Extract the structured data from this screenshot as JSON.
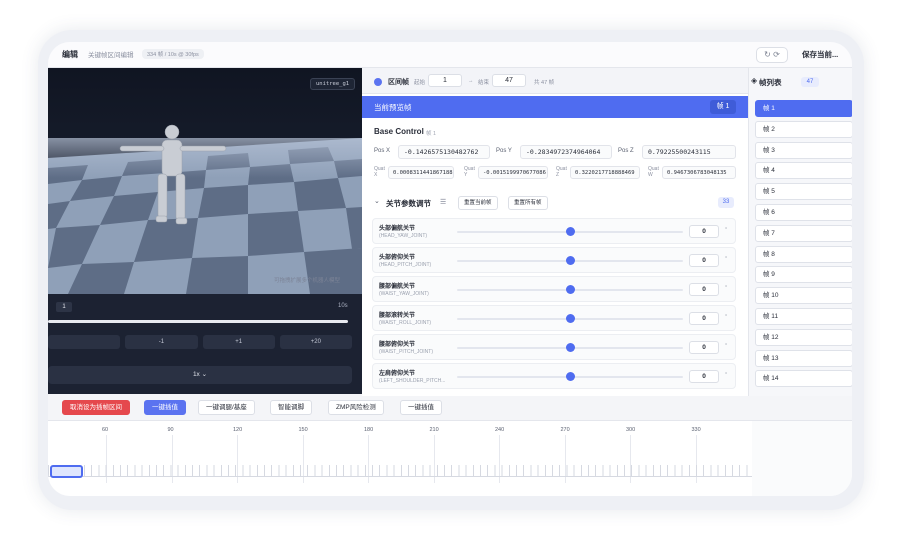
{
  "topbar": {
    "title": "编辑",
    "subtitle": "关键帧区间编辑",
    "meta": "334 帧 / 10s @ 30fps",
    "refresh_icons": "↻ ⟳",
    "save_label": "保存当前..."
  },
  "viewport": {
    "robot_tag": "unitree_g1",
    "hint": "可拖拽扩展多个机器人模型"
  },
  "playback": {
    "current_frame": "1",
    "duration": "10s",
    "progress": 0.0,
    "steps": [
      "",
      "-1",
      "+1",
      "+20"
    ],
    "speed": "1x ⌄"
  },
  "editor": {
    "range_label": "区间帧",
    "start_label": "起始",
    "start_value": "1",
    "arrow": "→",
    "end_label": "结束",
    "end_value": "47",
    "total_label": "共 47 帧",
    "current_title": "当前预览帧",
    "current_badge": "帧 1",
    "base_control": "Base Control",
    "base_frame": "帧 1",
    "pos": [
      {
        "label": "Pos X",
        "value": "-0.14265751304827​62"
      },
      {
        "label": "Pos Y",
        "value": "-0.2834972374964064"
      },
      {
        "label": "Pos Z",
        "value": "0.79225500243115"
      }
    ],
    "quat": [
      {
        "label": "Quat X",
        "value": "0.0008311441867188"
      },
      {
        "label": "Quat Y",
        "value": "-0.0015199970677086"
      },
      {
        "label": "Quat Z",
        "value": "0.3220217718888469"
      },
      {
        "label": "Quat W",
        "value": "0.9467306783048135"
      }
    ],
    "joint_section": "关节参数调节",
    "reset_current": "重置当前帧",
    "reset_all": "重置所有帧",
    "joint_count": "33",
    "joints": [
      {
        "name": "头部偏航关节",
        "id": "(HEAD_YAW_JOINT)",
        "value": "0",
        "level": 0.5
      },
      {
        "name": "头部俯仰关节",
        "id": "(HEAD_PITCH_JOINT)",
        "value": "0",
        "level": 0.5
      },
      {
        "name": "腰部偏航关节",
        "id": "(WAIST_YAW_JOINT)",
        "value": "0",
        "level": 0.5
      },
      {
        "name": "腰部滚转关节",
        "id": "(WAIST_ROLL_JOINT)",
        "value": "0",
        "level": 0.5
      },
      {
        "name": "腰部俯仰关节",
        "id": "(WAIST_PITCH_JOINT)",
        "value": "0",
        "level": 0.5
      },
      {
        "name": "左肩俯仰关节",
        "id": "(LEFT_SHOULDER_PITCH...",
        "value": "0",
        "level": 0.5
      }
    ],
    "unit": "°"
  },
  "framelist": {
    "title": "帧列表",
    "count": "47",
    "items": [
      "帧 1",
      "帧 2",
      "帧 3",
      "帧 4",
      "帧 5",
      "帧 6",
      "帧 7",
      "帧 8",
      "帧 9",
      "帧 10",
      "帧 11",
      "帧 12",
      "帧 13",
      "帧 14"
    ]
  },
  "tools": {
    "cancel_range": "取消设为插帧区间",
    "one_click_interp": "一键插值",
    "one_click_base": "一键调腿/基座",
    "smart_adjust": "智能调脚",
    "zmp_check": "ZMP风险检测",
    "one_click_interp2": "一键插值"
  },
  "timeline": {
    "ticks": [
      "60",
      "90",
      "120",
      "150",
      "180",
      "210",
      "240",
      "270",
      "300",
      "330"
    ]
  },
  "colors": {
    "accent": "#4f6cf0",
    "danger": "#e5484d",
    "viewport_bg": "#141a28"
  }
}
